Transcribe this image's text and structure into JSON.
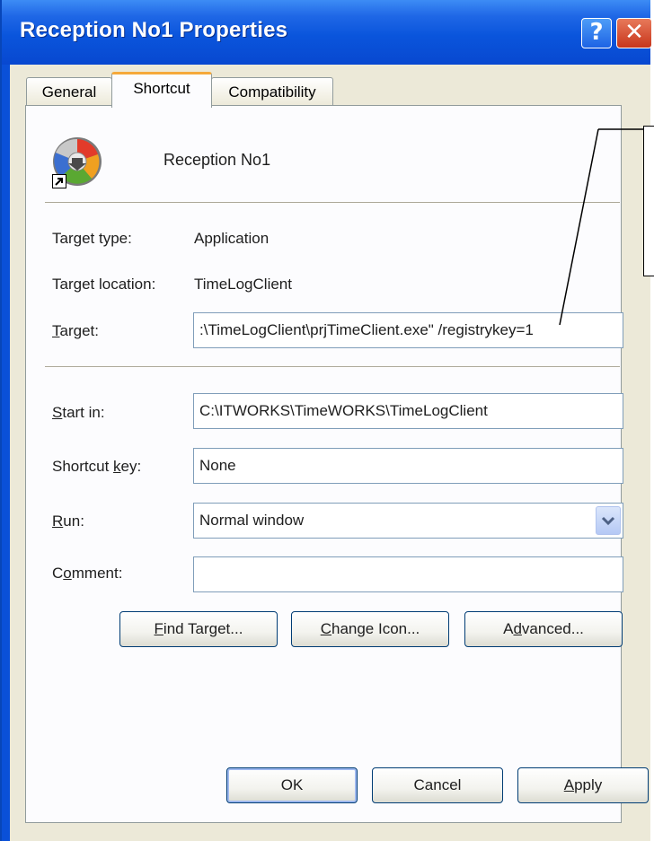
{
  "window": {
    "title": "Reception No1 Properties",
    "help_label": "?",
    "close_label": "✕"
  },
  "tabs": [
    {
      "label": "General",
      "active": false
    },
    {
      "label": "Shortcut",
      "active": true
    },
    {
      "label": "Compatibility",
      "active": false
    }
  ],
  "shortcut": {
    "name": "Reception No1",
    "target_type_label": "Target type:",
    "target_type_value": "Application",
    "target_location_label": "Target location:",
    "target_location_value": "TimeLogClient",
    "target_label_u": "T",
    "target_label_rest": "arget:",
    "target_value": ":\\TimeLogClient\\prjTimeClient.exe\" /registrykey=1",
    "start_in_label_u": "S",
    "start_in_label_rest": "tart in:",
    "start_in_value": "C:\\ITWORKS\\TimeWORKS\\TimeLogClient",
    "shortcut_key_label_pre": "Shortcut ",
    "shortcut_key_label_u": "k",
    "shortcut_key_label_rest": "ey:",
    "shortcut_key_value": "None",
    "run_label_u": "R",
    "run_label_rest": "un:",
    "run_value": "Normal window",
    "comment_label_pre": "C",
    "comment_label_u": "o",
    "comment_label_rest": "mment:",
    "comment_value": ""
  },
  "buttons": {
    "find_target_u": "F",
    "find_target_rest": "ind Target...",
    "change_icon_u": "C",
    "change_icon_rest": "hange Icon...",
    "advanced_pre": "A",
    "advanced_u": "d",
    "advanced_rest": "vanced...",
    "ok": "OK",
    "cancel": "Cancel",
    "apply_u": "A",
    "apply_rest": "pply"
  },
  "icons": {
    "app_icon": "colorful-disc-shortcut-icon",
    "shortcut_overlay": "shortcut-arrow-icon",
    "dropdown": "chevron-down-icon"
  },
  "colors": {
    "titlebar": "#0a55dc",
    "dialog_bg": "#ece9d8",
    "active_tab_accent": "#f5a93a",
    "field_border": "#7f9db9",
    "button_border": "#003c74"
  }
}
